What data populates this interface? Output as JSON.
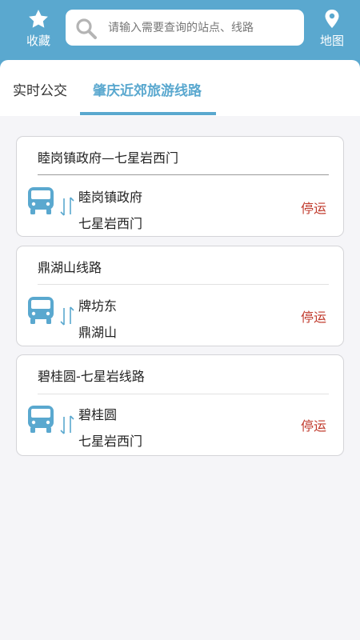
{
  "header": {
    "favorites_label": "收藏",
    "map_label": "地图",
    "search_placeholder": "请输入需要查询的站点、线路",
    "bg_color": "#5aa8cf"
  },
  "tabs": [
    {
      "label": "实时公交",
      "active": false
    },
    {
      "label": "肇庆近郊旅游线路",
      "active": true
    }
  ],
  "routes": [
    {
      "name": "睦岗镇政府—七星岩西门",
      "from": "睦岗镇政府",
      "to": "七星岩西门",
      "status": "停运"
    },
    {
      "name": "鼎湖山线路",
      "from": "牌坊东",
      "to": "鼎湖山",
      "status": "停运"
    },
    {
      "name": "碧桂圆-七星岩线路",
      "from": "碧桂圆",
      "to": "七星岩西门",
      "status": "停运"
    }
  ],
  "icons": {
    "favorites": "star-icon",
    "search": "search-icon",
    "map": "map-pin-icon",
    "bus": "bus-icon",
    "direction": "two-way-arrows-icon"
  },
  "colors": {
    "accent": "#5aa8cf",
    "status_stopped": "#c0392b"
  }
}
